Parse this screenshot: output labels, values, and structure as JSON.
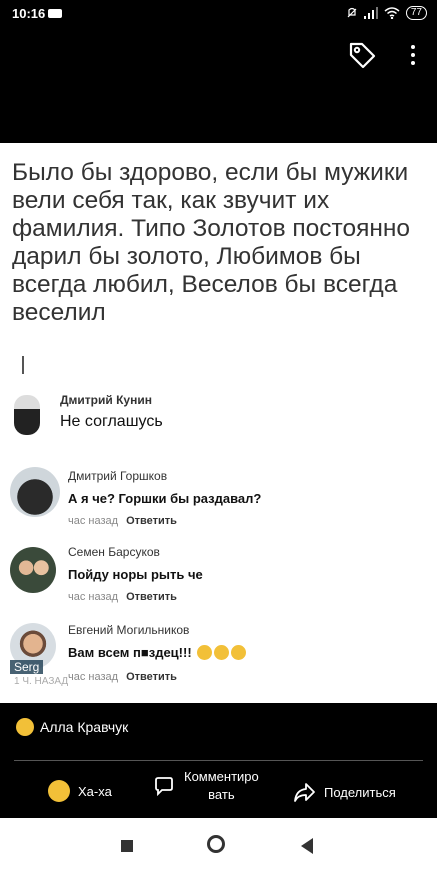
{
  "status": {
    "time": "10:16",
    "battery": "77"
  },
  "post": {
    "quote": "Было бы здорово, если бы мужики вели себя так, как звучит их фамилия. Типо Золотов постоянно дарил бы золото, Любимов бы всегда любил, Веселов бы всегда веселил"
  },
  "comments": [
    {
      "name": "Дмитрий Кунин",
      "text": "Не соглашусь"
    },
    {
      "name": "Дмитрий Горшков",
      "text": "А я че? Горшки бы раздавал?",
      "time": "час назад",
      "reply": "Ответить"
    },
    {
      "name": "Семен Барсуков",
      "text": "Пойду норы рыть че",
      "time": "час назад",
      "reply": "Ответить"
    },
    {
      "name": "Евгений Могильников",
      "text": "Вам всем п■здец!!!",
      "time": "час назад",
      "reply": "Ответить"
    }
  ],
  "watermark": {
    "name": "Serg",
    "sub": "1 Ч. НАЗАД"
  },
  "reaction": {
    "user": "Алла Кравчук"
  },
  "actions": {
    "haha": "Ха-ха",
    "comment_line1": "Комментиро",
    "comment_line2": "вать",
    "share": "Поделиться"
  },
  "icons": [
    "tag-icon",
    "more-vertical-icon",
    "laugh-emoji-icon",
    "comment-bubble-icon",
    "share-arrow-icon"
  ],
  "colors": {
    "emoji": "#f2c038",
    "background": "#000000",
    "image_bg": "#ffffff"
  }
}
